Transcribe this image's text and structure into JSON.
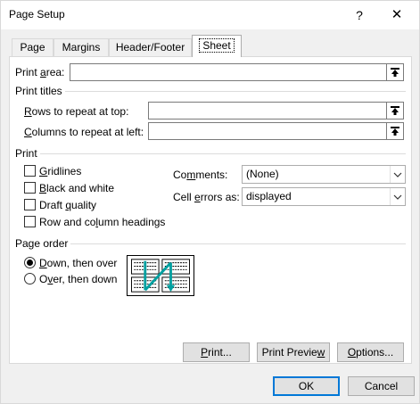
{
  "window": {
    "title": "Page Setup",
    "help": "?",
    "close": "✕"
  },
  "tabs": [
    {
      "label": "Page",
      "active": false
    },
    {
      "label": "Margins",
      "active": false
    },
    {
      "label": "Header/Footer",
      "active": false
    },
    {
      "label": "Sheet",
      "active": true
    }
  ],
  "print_area": {
    "label_pre": "Print ",
    "label_key": "a",
    "label_post": "rea:",
    "value": ""
  },
  "print_titles": {
    "title": "Print titles",
    "rows": {
      "label_pre": "",
      "label_key": "R",
      "label_post": "ows to repeat at top:",
      "value": ""
    },
    "columns": {
      "label_pre": "",
      "label_key": "C",
      "label_post": "olumns to repeat at left:",
      "value": ""
    }
  },
  "print": {
    "title": "Print",
    "options": [
      {
        "pre": "",
        "key": "G",
        "post": "ridlines",
        "checked": false
      },
      {
        "pre": "",
        "key": "B",
        "post": "lack and white",
        "checked": false
      },
      {
        "pre": "Draft ",
        "key": "q",
        "post": "uality",
        "checked": false
      },
      {
        "pre": "Row and co",
        "key": "l",
        "post": "umn headings",
        "checked": false
      }
    ],
    "comments": {
      "label_pre": "Co",
      "label_key": "m",
      "label_post": "ments:",
      "value": "(None)"
    },
    "cell_errors": {
      "label_pre": "Cell ",
      "label_key": "e",
      "label_post": "rrors as:",
      "value": "displayed"
    }
  },
  "page_order": {
    "title": "Page order",
    "options": [
      {
        "pre": "",
        "key": "D",
        "post": "own, then over",
        "checked": true
      },
      {
        "pre": "O",
        "key": "v",
        "post": "er, then down",
        "checked": false
      }
    ]
  },
  "buttons": {
    "print_pre": "",
    "print_key": "P",
    "print_post": "rint...",
    "preview_pre": "Print Previe",
    "preview_key": "w",
    "preview_post": "",
    "options_pre": "",
    "options_key": "O",
    "options_post": "ptions...",
    "ok": "OK",
    "cancel": "Cancel"
  },
  "colors": {
    "accent": "#0078d7",
    "preview_arrow": "#00a0a0"
  }
}
